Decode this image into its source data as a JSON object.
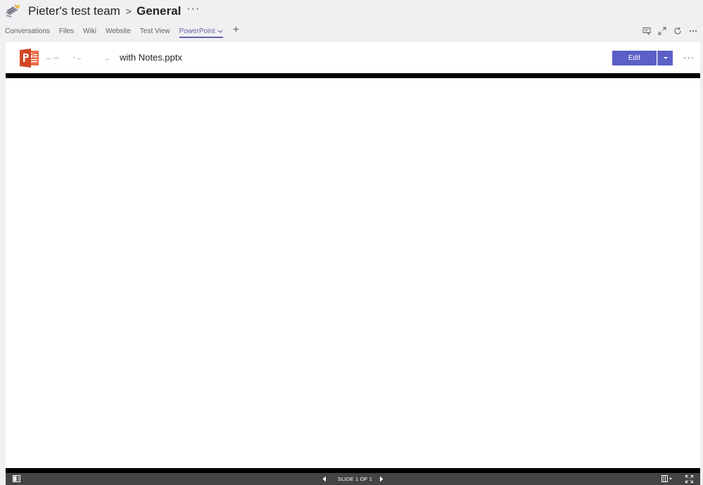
{
  "header": {
    "team_name": "Pieter's test team",
    "separator": ">",
    "channel_name": "General",
    "more": "···"
  },
  "tabs": [
    {
      "label": "Conversations",
      "active": false
    },
    {
      "label": "Files",
      "active": false
    },
    {
      "label": "Wiki",
      "active": false
    },
    {
      "label": "Website",
      "active": false
    },
    {
      "label": "Test View",
      "active": false
    },
    {
      "label": "PowerPoint",
      "active": true
    }
  ],
  "tab_add": "+",
  "toolbar_icons": [
    "conversation-icon",
    "expand-icon",
    "refresh-icon",
    "more-icon"
  ],
  "document": {
    "filename_visible": "with Notes.pptx",
    "edit_label": "Edit",
    "more": "···"
  },
  "status_bar": {
    "slide_label": "SLIDE 1 OF 1"
  },
  "colors": {
    "accent": "#6264a7",
    "edit_button": "#5b5fc7",
    "powerpoint": "#d24726",
    "status_bar": "#444444"
  }
}
